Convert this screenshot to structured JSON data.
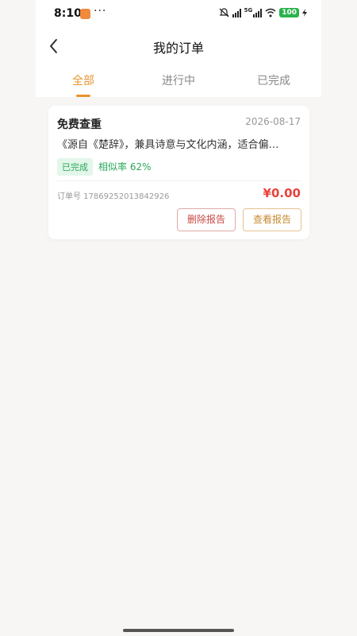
{
  "status_bar": {
    "time": "8:10",
    "dots": "···",
    "battery": "100",
    "network": "5G"
  },
  "header": {
    "title": "我的订单",
    "back_icon": "chevron-left-icon"
  },
  "tabs": [
    {
      "label": "全部",
      "active": true
    },
    {
      "label": "进行中",
      "active": false
    },
    {
      "label": "已完成",
      "active": false
    }
  ],
  "orders": [
    {
      "type": "免费查重",
      "date": "2026-08-17",
      "description": "《源自《楚辞》，兼具诗意与文化内涵，适合偏…",
      "status": "已完成",
      "similarity": "相似率 62%",
      "order_no": "订单号 17869252013842926",
      "price": "¥0.00",
      "delete_label": "删除报告",
      "view_label": "查看报告"
    }
  ],
  "colors": {
    "accent": "#e6952f",
    "success": "#2aa85a",
    "price": "#e8433d"
  }
}
